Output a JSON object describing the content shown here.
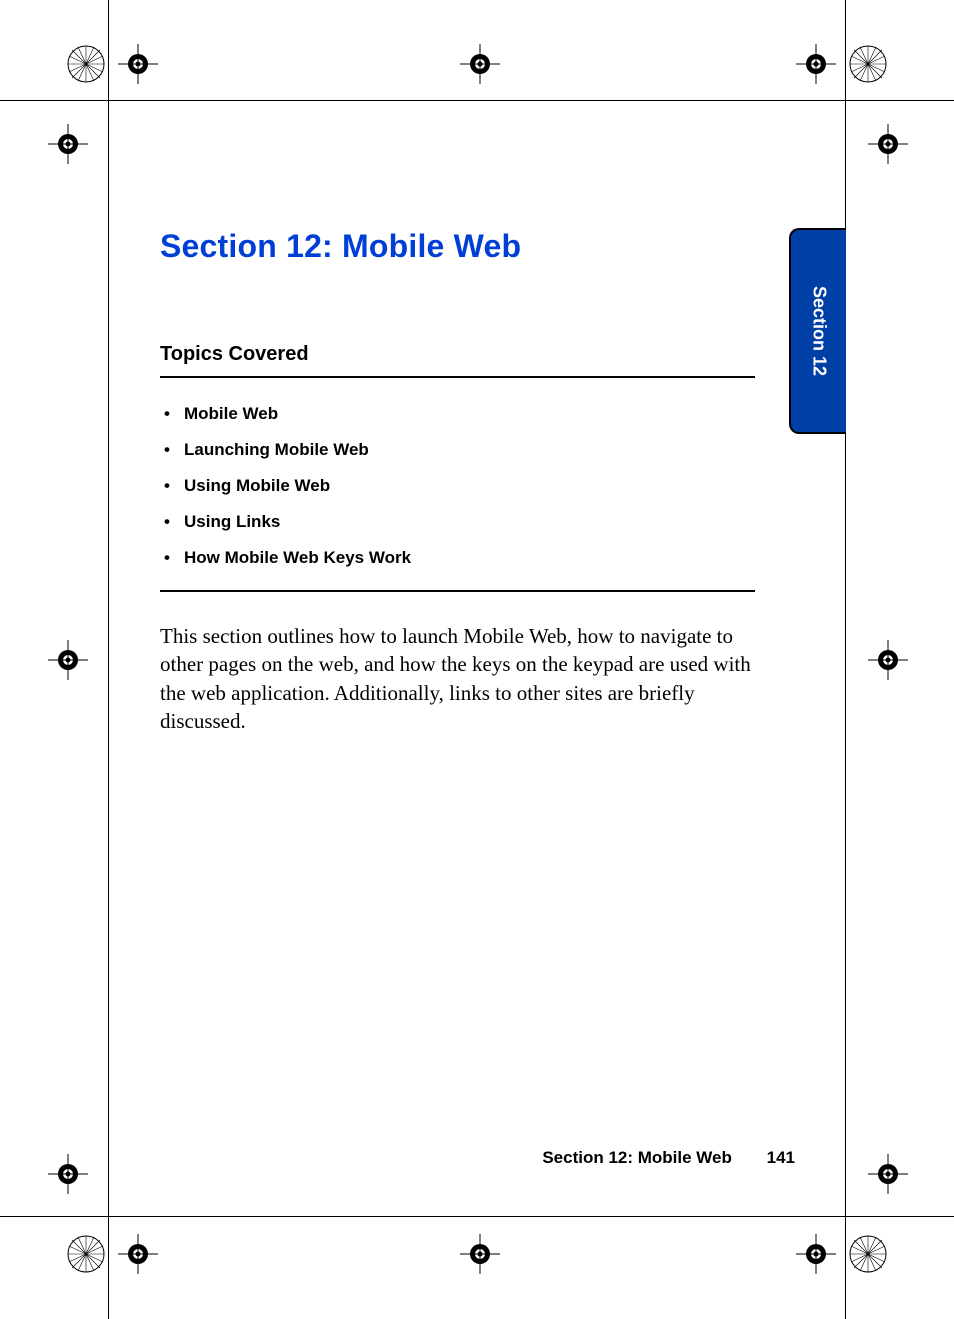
{
  "title": "Section 12: Mobile Web",
  "subhead": "Topics Covered",
  "topics": [
    "Mobile Web",
    "Launching Mobile Web",
    "Using Mobile Web",
    "Using Links",
    "How Mobile Web Keys Work"
  ],
  "body": "This section outlines how to launch Mobile Web, how to navigate to other pages on the web, and how the keys on the keypad are used with the web application. Additionally, links to other sites are briefly discussed.",
  "sidetab": "Section 12",
  "footer": {
    "label": "Section 12: Mobile Web",
    "page": "141"
  }
}
